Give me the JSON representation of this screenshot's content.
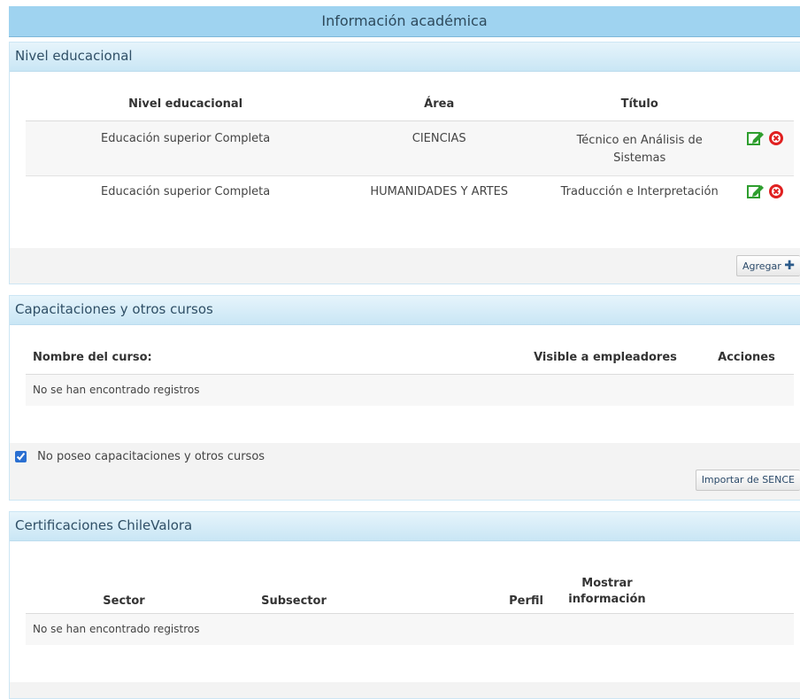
{
  "header": {
    "title": "Información académica"
  },
  "nivel": {
    "title": "Nivel educacional",
    "columns": [
      "Nivel educacional",
      "Área",
      "Título"
    ],
    "rows": [
      {
        "nivel": "Educación superior Completa",
        "area": "CIENCIAS",
        "titulo": "Técnico en Análisis de Sistemas"
      },
      {
        "nivel": "Educación superior Completa",
        "area": "HUMANIDADES Y ARTES",
        "titulo": "Traducción e Interpretación"
      }
    ],
    "add_label": "Agregar"
  },
  "cursos": {
    "title": "Capacitaciones y otros cursos",
    "columns": [
      "Nombre del curso:",
      "Visible a empleadores",
      "Acciones"
    ],
    "empty": "No se han encontrado registros",
    "checkbox_label": "No poseo capacitaciones y otros cursos",
    "checkbox_checked": true,
    "import_label": "Importar de SENCE"
  },
  "certs": {
    "title": "Certificaciones ChileValora",
    "columns": [
      "Sector",
      "Subsector",
      "Perfil",
      "Mostrar información"
    ],
    "empty": "No se han encontrado registros"
  },
  "colors": {
    "edit": "#2e9e2e",
    "delete": "#e02020",
    "header_bg": "#9fd3f0"
  }
}
